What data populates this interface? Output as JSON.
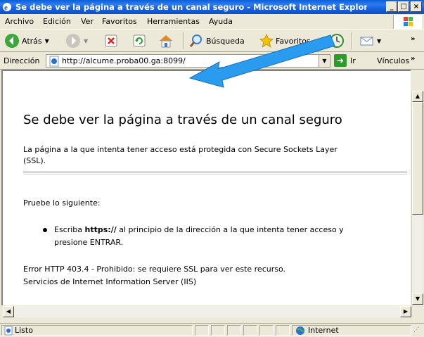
{
  "window": {
    "title": "Se debe ver la página a través de un canal seguro - Microsoft Internet Explorer",
    "minimize_glyph": "_",
    "maximize_glyph": "□",
    "close_glyph": "×"
  },
  "menu": {
    "items": [
      {
        "label": "Archivo"
      },
      {
        "label": "Edición"
      },
      {
        "label": "Ver"
      },
      {
        "label": "Favoritos"
      },
      {
        "label": "Herramientas"
      },
      {
        "label": "Ayuda"
      }
    ]
  },
  "toolbar": {
    "back_label": "Atrás",
    "search_label": "Búsqueda",
    "favorites_label": "Favoritos"
  },
  "address": {
    "label": "Dirección",
    "url": "http://alcume.proba00.ga:8099/",
    "go_label": "Ir",
    "links_label": "Vínculos"
  },
  "page": {
    "heading": "Se debe ver la página a través de un canal seguro",
    "intro_line1": "La página a la que intenta tener acceso está protegida con Secure Sockets Layer",
    "intro_line2": "(SSL).",
    "try_text": "Pruebe lo siguiente:",
    "bullet_prefix": "Escriba ",
    "bullet_bold": "https://",
    "bullet_suffix": " al principio de la dirección a la que intenta tener acceso y",
    "bullet_line2": "presione ENTRAR.",
    "error_line": "Error HTTP 403.4 - Prohibido: se requiere SSL para ver este recurso.",
    "server_line": "Servicios de Internet Information Server (IIS)"
  },
  "status": {
    "left_text": "Listo",
    "zone_text": "Internet"
  },
  "colors": {
    "titlebar_blue": "#0a5fd8",
    "arrow_blue": "#2a9cf0",
    "chrome": "#ece9d8"
  }
}
